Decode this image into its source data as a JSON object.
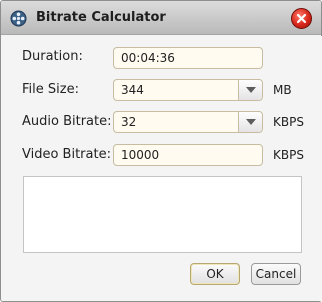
{
  "window": {
    "title": "Bitrate Calculator",
    "app_icon": "film-reel-icon",
    "close_icon": "close-icon"
  },
  "form": {
    "duration": {
      "label": "Duration:",
      "value": "00:04:36"
    },
    "file_size": {
      "label": "File Size:",
      "value": "344",
      "unit": "MB"
    },
    "audio_bitrate": {
      "label": "Audio Bitrate:",
      "value": "32",
      "unit": "KBPS"
    },
    "video_bitrate": {
      "label": "Video Bitrate:",
      "value": "10000",
      "unit": "KBPS"
    }
  },
  "notes": {
    "value": ""
  },
  "buttons": {
    "ok": "OK",
    "cancel": "Cancel"
  },
  "colors": {
    "field_bg": "#fffbf0",
    "field_border": "#c7bca2",
    "close_red": "#d8261a",
    "titlebar_top": "#dcdcdc",
    "titlebar_bottom": "#b9b9b9"
  }
}
